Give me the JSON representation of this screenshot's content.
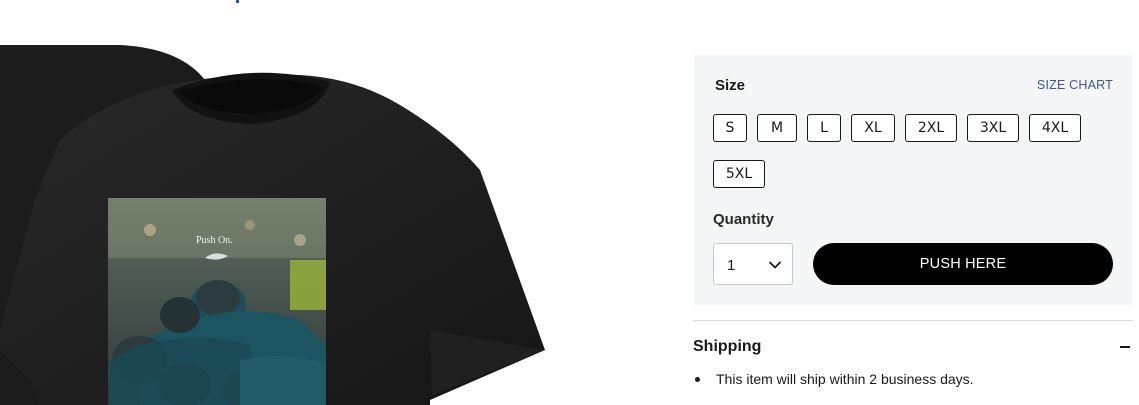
{
  "product": {
    "image_alt": "black t-shirt with Eagles graphic",
    "graphic_text": "Push On."
  },
  "purchase": {
    "size_label": "Size",
    "size_chart_label": "SIZE CHART",
    "sizes": [
      "S",
      "M",
      "L",
      "XL",
      "2XL",
      "3XL",
      "4XL",
      "5XL"
    ],
    "quantity_label": "Quantity",
    "quantity_value": "1",
    "push_button_label": "PUSH HERE"
  },
  "shipping": {
    "title": "Shipping",
    "items": [
      "This item will ship within 2 business days."
    ]
  },
  "colors": {
    "panel_bg": "#f4f5f7",
    "button_bg": "#000000",
    "link": "#3a5a8c",
    "eagles_green": "#1f4e5a"
  }
}
